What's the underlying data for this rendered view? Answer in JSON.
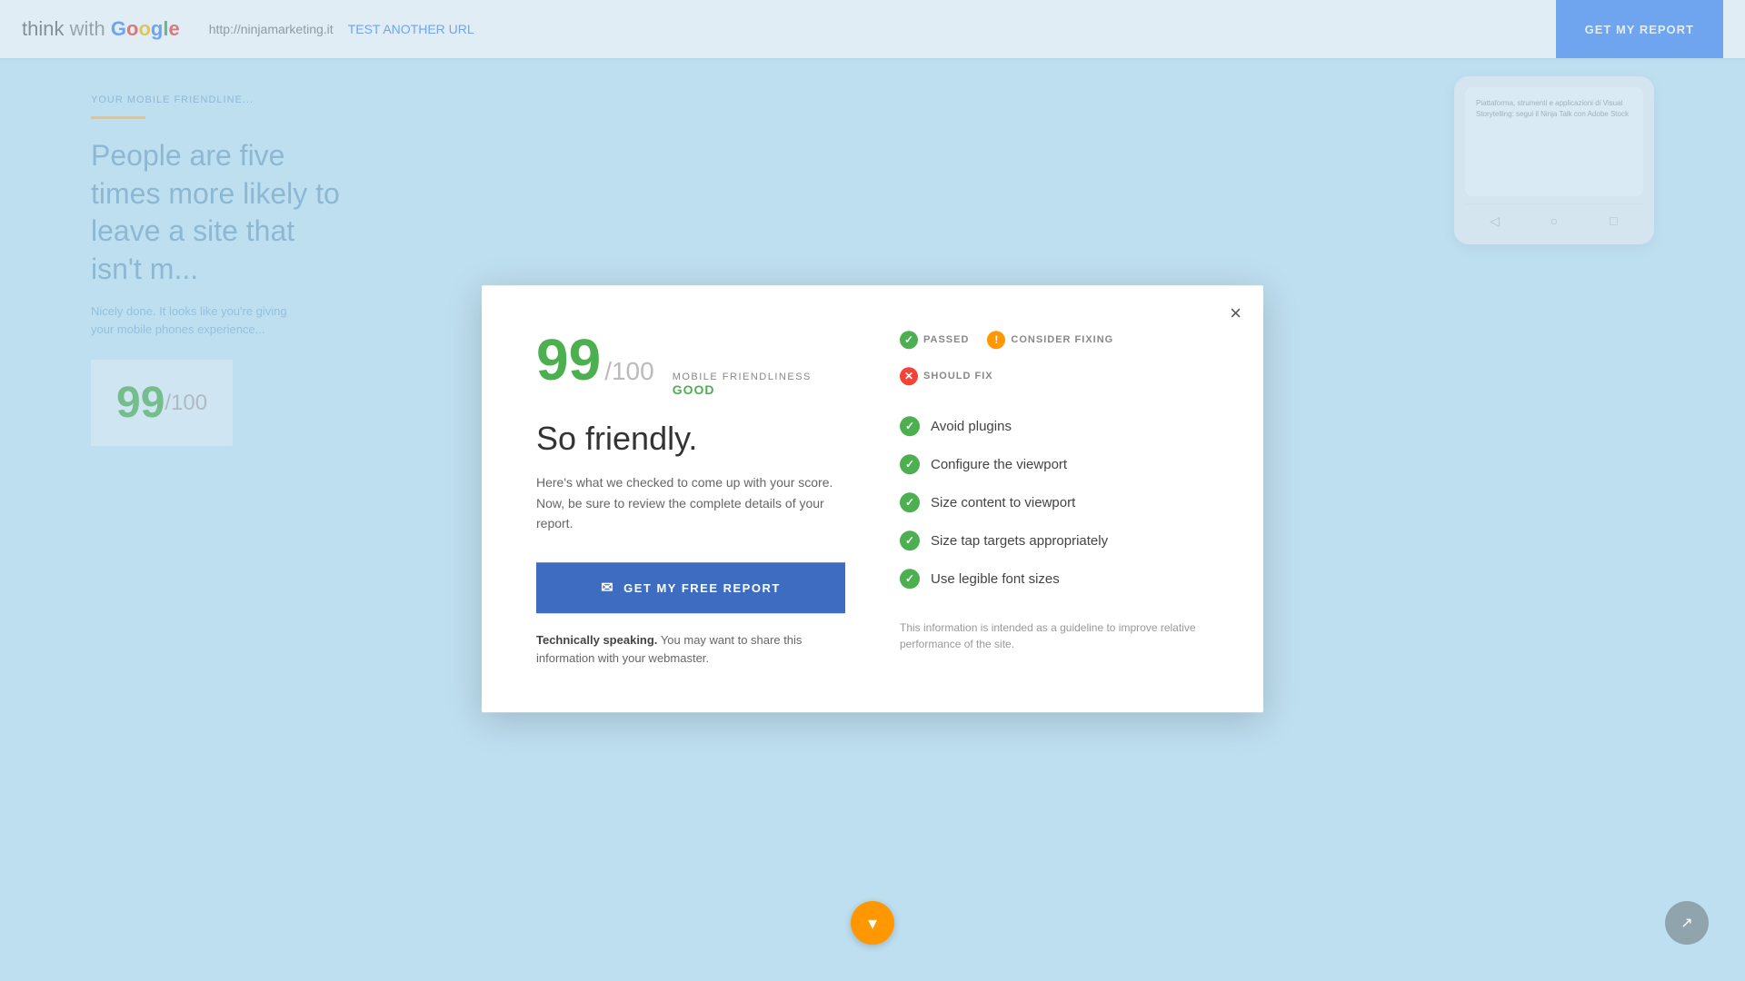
{
  "header": {
    "logo": {
      "think": "think",
      "with": "with",
      "google": "Google"
    },
    "url": "http://ninjamarketing.it",
    "test_link": "TEST ANOTHER URL",
    "get_report_btn": "GET MY REPORT"
  },
  "modal": {
    "close_label": "×",
    "score": {
      "value": "99",
      "denominator": "/100",
      "category": "MOBILE FRIENDLINESS",
      "status": "GOOD"
    },
    "tagline": "So friendly.",
    "description": "Here's what we checked to come up with your score. Now, be sure to review the complete details of your report.",
    "get_report_button": "GET MY FREE REPORT",
    "technical_note_bold": "Technically speaking.",
    "technical_note": " You may want to share this information with your webmaster.",
    "legend": [
      {
        "type": "green",
        "label": "PASSED",
        "icon": "✓"
      },
      {
        "type": "yellow",
        "label": "CONSIDER FIXING",
        "icon": "!"
      },
      {
        "type": "red",
        "label": "SHOULD FIX",
        "icon": "✕"
      }
    ],
    "checks": [
      {
        "label": "Avoid plugins",
        "status": "passed"
      },
      {
        "label": "Configure the viewport",
        "status": "passed"
      },
      {
        "label": "Size content to viewport",
        "status": "passed"
      },
      {
        "label": "Size tap targets appropriately",
        "status": "passed"
      },
      {
        "label": "Use legible font sizes",
        "status": "passed"
      }
    ],
    "disclaimer": "This information is intended as a guideline to improve relative performance of the site."
  },
  "bg": {
    "score_display": "99",
    "score_denom": "/100",
    "mobile_text_line1": "Piattaforma, strumenti e applicazioni di Visual",
    "mobile_text_line2": "Storytelling: segui il Ninja Talk con Adobe Stock"
  },
  "scroll_down_icon": "▾",
  "share_icon": "↗"
}
